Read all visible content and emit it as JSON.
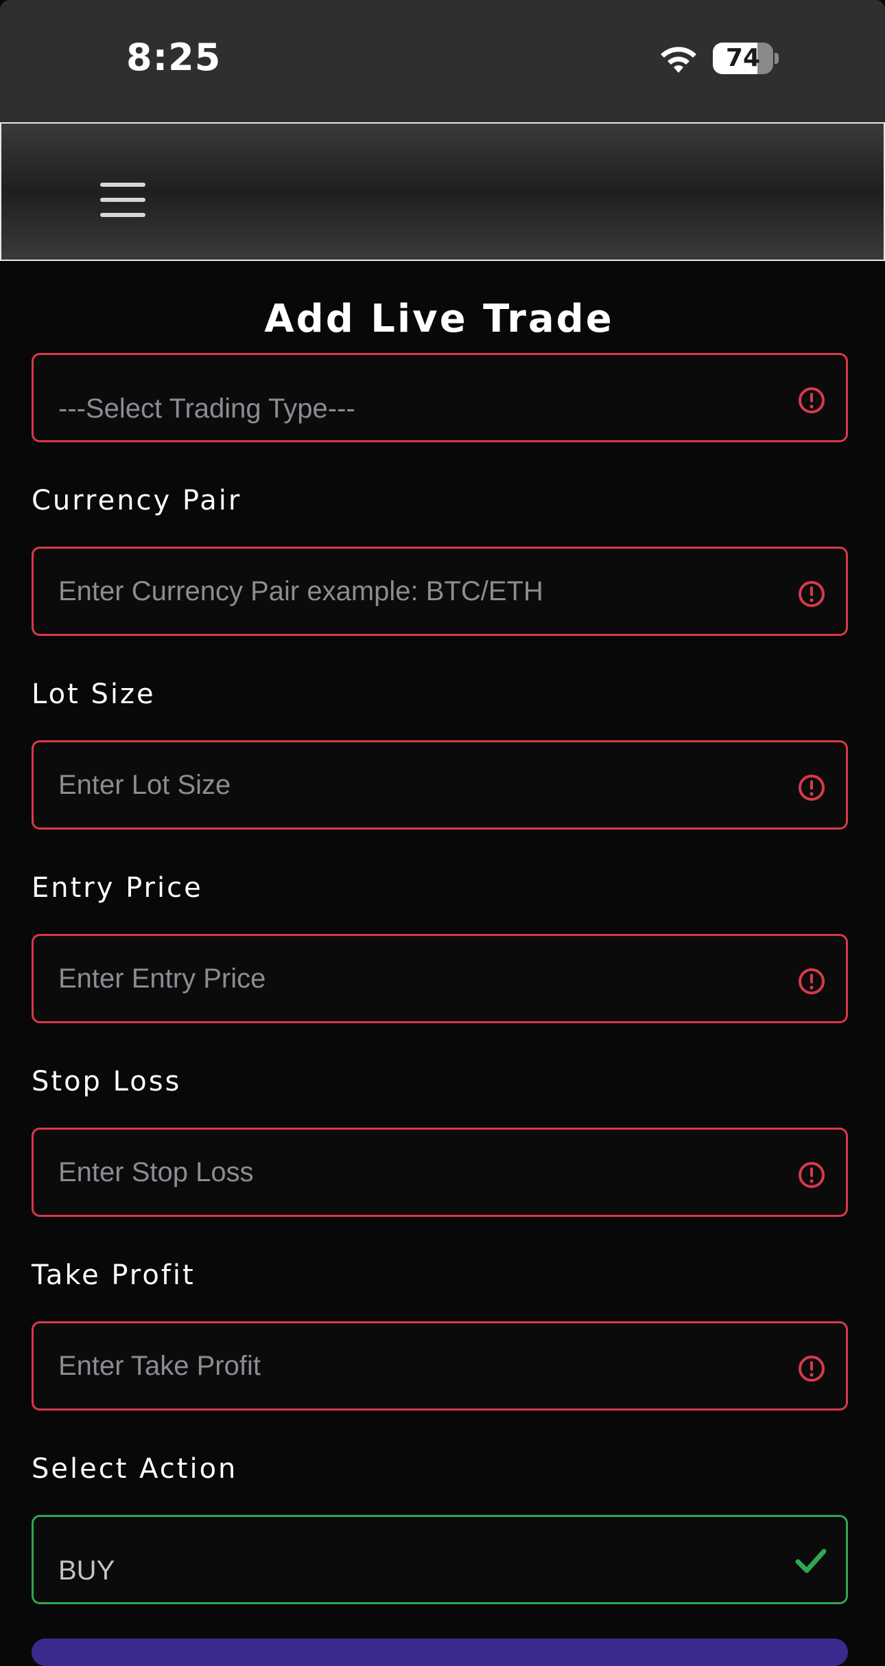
{
  "status_bar": {
    "time": "8:25",
    "battery_level": "74",
    "battery_fraction": 0.74
  },
  "header": {
    "menu_icon": "hamburger-menu-icon"
  },
  "page": {
    "title": "Add Live Trade"
  },
  "form": {
    "trading_type": {
      "placeholder": "---Select Trading Type---",
      "state": "error"
    },
    "currency_pair": {
      "label": "Currency Pair",
      "placeholder": "Enter Currency Pair example: BTC/ETH",
      "value": "",
      "state": "error"
    },
    "lot_size": {
      "label": "Lot Size",
      "placeholder": "Enter Lot Size",
      "value": "",
      "state": "error"
    },
    "entry_price": {
      "label": "Entry Price",
      "placeholder": "Enter Entry Price",
      "value": "",
      "state": "error"
    },
    "stop_loss": {
      "label": "Stop Loss",
      "placeholder": "Enter Stop Loss",
      "value": "",
      "state": "error"
    },
    "take_profit": {
      "label": "Take Profit",
      "placeholder": "Enter Take Profit",
      "value": "",
      "state": "error"
    },
    "action": {
      "label": "Select Action",
      "value": "BUY",
      "state": "valid"
    }
  },
  "colors": {
    "error": "#d9394b",
    "valid": "#2fa84f",
    "background": "#080809",
    "submit_accent": "#3b2a8e"
  }
}
